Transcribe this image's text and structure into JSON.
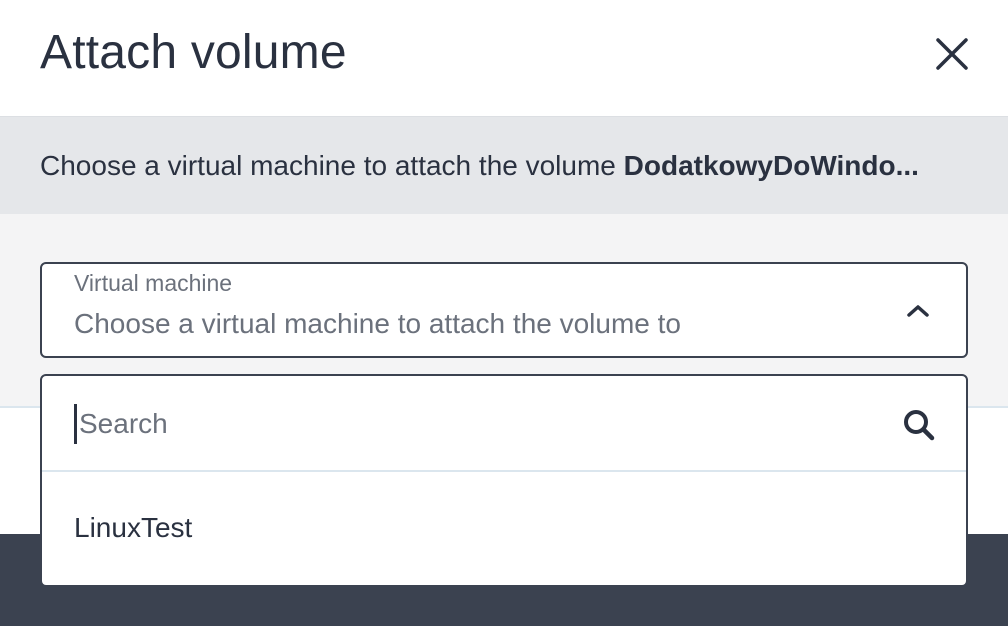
{
  "dialog": {
    "title": "Attach volume",
    "close_icon": "close-icon"
  },
  "info": {
    "prefix": "Choose a virtual machine to attach the volume ",
    "volume_name": "DodatkowyDoWindo..."
  },
  "select": {
    "label": "Virtual machine",
    "placeholder": "Choose a virtual machine to attach the volume to",
    "chevron_icon": "chevron-up-icon"
  },
  "dropdown": {
    "search_placeholder": "Search",
    "search_value": "",
    "search_icon": "search-icon",
    "options": [
      {
        "label": "LinuxTest"
      }
    ]
  },
  "colors": {
    "text": "#2a3140",
    "muted": "#6b717c",
    "info_bar": "#e5e7ea",
    "content_bg": "#f4f4f5",
    "footer": "#3b4250",
    "border": "#3b4250"
  }
}
